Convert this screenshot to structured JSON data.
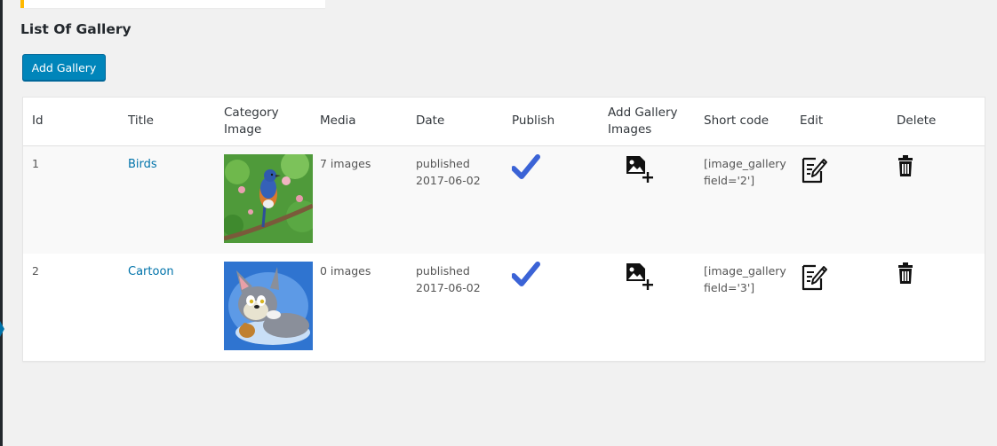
{
  "page": {
    "title": "List Of Gallery",
    "add_button": "Add Gallery"
  },
  "table": {
    "headers": {
      "id": "Id",
      "title": "Title",
      "category_image": "Category Image",
      "media": "Media",
      "date": "Date",
      "publish": "Publish",
      "add_gallery_images": "Add Gallery Images",
      "short_code": "Short code",
      "edit": "Edit",
      "delete": "Delete"
    },
    "rows": [
      {
        "id": "1",
        "title": "Birds",
        "media": "7 images",
        "date_status": "published",
        "date": "2017-06-02",
        "shortcode_line1": "[image_gallery",
        "shortcode_line2": "field='2']"
      },
      {
        "id": "2",
        "title": "Cartoon",
        "media": "0 images",
        "date_status": "published",
        "date": "2017-06-02",
        "shortcode_line1": "[image_gallery",
        "shortcode_line2": "field='3']"
      }
    ]
  },
  "icons": {
    "publish": "checkmark-icon",
    "add_images": "add-image-icon",
    "edit": "edit-icon",
    "delete": "trash-icon"
  },
  "colors": {
    "accent": "#0085ba",
    "link": "#0073aa",
    "check": "#3b63d6",
    "notice": "#ffb900"
  }
}
